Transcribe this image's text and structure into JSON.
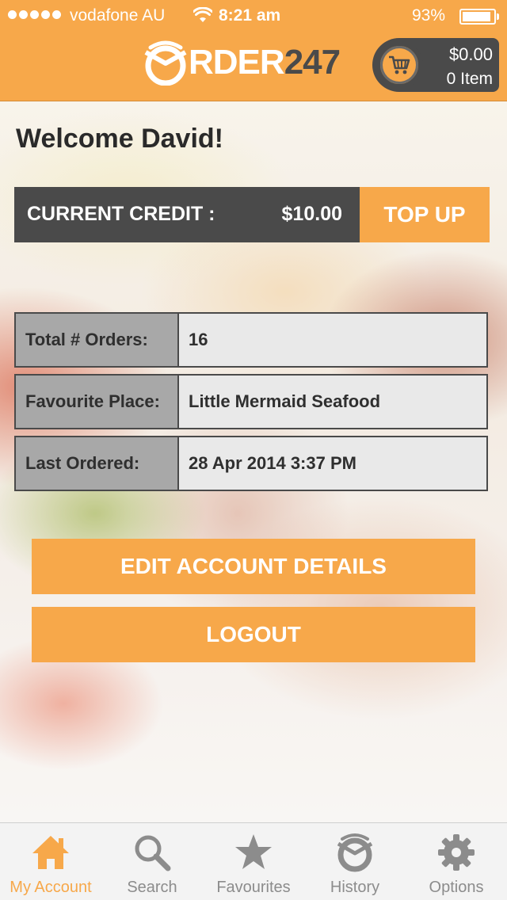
{
  "status_bar": {
    "carrier": "vodafone AU",
    "time": "8:21 am",
    "battery_percent": "93%",
    "battery_level": 0.93
  },
  "header": {
    "logo_text_primary": "RDER",
    "logo_text_secondary": "247",
    "cart": {
      "amount": "$0.00",
      "items": "0 Item"
    }
  },
  "account": {
    "welcome": "Welcome David!",
    "credit_label": "CURRENT CREDIT :",
    "credit_value": "$10.00",
    "top_up_label": "TOP UP",
    "stats": [
      {
        "label": "Total # Orders:",
        "value": "16"
      },
      {
        "label": "Favourite Place:",
        "value": "Little Mermaid Seafood"
      },
      {
        "label": "Last Ordered:",
        "value": "28 Apr 2014 3:37 PM"
      }
    ],
    "edit_button": "EDIT ACCOUNT DETAILS",
    "logout_button": "LOGOUT"
  },
  "tabs": [
    {
      "label": "My Account",
      "icon": "home-icon",
      "active": true
    },
    {
      "label": "Search",
      "icon": "search-icon",
      "active": false
    },
    {
      "label": "Favourites",
      "icon": "star-icon",
      "active": false
    },
    {
      "label": "History",
      "icon": "history-icon",
      "active": false
    },
    {
      "label": "Options",
      "icon": "gear-icon",
      "active": false
    }
  ],
  "colors": {
    "accent": "#f7a84a",
    "dark": "#4a4a4a",
    "inactive": "#8c8c8c"
  }
}
